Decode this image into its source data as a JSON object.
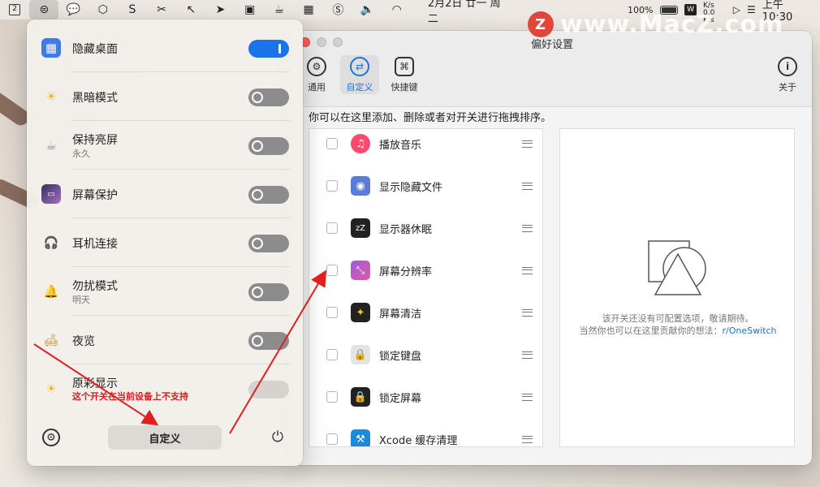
{
  "menubar": {
    "icons": [
      "2",
      "onedrag-icon",
      "wechat-icon",
      "coinbase-icon",
      "scrivener-icon",
      "papercut-icon",
      "cursor-icon",
      "send-icon",
      "screen-icon",
      "coffee-icon",
      "grid-icon",
      "s-icon",
      "volume-icon",
      "wifi-icon"
    ],
    "box_label": "2",
    "date": "2月2日 廿一 周二",
    "battery": "100%",
    "net_up": "0.0 K/s",
    "net_down": "0.0 K/s",
    "time": "上午 10:30"
  },
  "watermark": {
    "logo": "Z",
    "text": "www.MacZ.com"
  },
  "dropdown": {
    "items": [
      {
        "title": "隐藏桌面",
        "subtitle": "",
        "state": "on",
        "icon": "grid-icon",
        "color": "#3e7be6"
      },
      {
        "title": "黑暗模式",
        "subtitle": "",
        "state": "off",
        "icon": "sun-icon",
        "color": "#f3b61f"
      },
      {
        "title": "保持亮屏",
        "subtitle": "永久",
        "state": "off",
        "icon": "coffee-icon",
        "color": "#ffffff"
      },
      {
        "title": "屏幕保护",
        "subtitle": "",
        "state": "off",
        "icon": "screensaver-icon",
        "color": "#3b2f5e"
      },
      {
        "title": "耳机连接",
        "subtitle": "",
        "state": "off",
        "icon": "headphones-icon",
        "color": "#f0a030"
      },
      {
        "title": "勿扰模式",
        "subtitle": "明天",
        "state": "off",
        "icon": "bell-icon",
        "color": "#e0a030"
      },
      {
        "title": "夜览",
        "subtitle": "",
        "state": "off",
        "icon": "lamp-icon",
        "color": "#f0c040"
      },
      {
        "title": "原彩显示",
        "subtitle": "这个开关在当前设备上不支持",
        "state": "disabled",
        "icon": "true-tone-icon",
        "color": "#f3b61f"
      }
    ],
    "custom_label": "自定义"
  },
  "prefs": {
    "title": "偏好设置",
    "tabs": [
      {
        "label": "通用",
        "icon": "gear-icon",
        "glyph": "⚙"
      },
      {
        "label": "自定义",
        "icon": "sliders-icon",
        "glyph": "⇄"
      },
      {
        "label": "快捷键",
        "icon": "command-icon",
        "glyph": "⌘"
      }
    ],
    "about_label": "关于",
    "about_glyph": "i",
    "instruction": "你可以在这里添加、删除或者对开关进行拖拽排序。",
    "list": [
      {
        "label": "播放音乐",
        "icon": "music-icon",
        "color": "#fa4b6c"
      },
      {
        "label": "显示隐藏文件",
        "icon": "eye-icon",
        "color": "#5a7bd8"
      },
      {
        "label": "显示器休眠",
        "icon": "sleep-display-icon",
        "color": "#222222"
      },
      {
        "label": "屏幕分辨率",
        "icon": "resolution-icon",
        "color": "#9c5ce0"
      },
      {
        "label": "屏幕清洁",
        "icon": "clean-screen-icon",
        "color": "#222222"
      },
      {
        "label": "锁定键盘",
        "icon": "keyboard-lock-icon",
        "color": "#d8d8d8"
      },
      {
        "label": "锁定屏幕",
        "icon": "screen-lock-icon",
        "color": "#222222"
      },
      {
        "label": "Xcode 缓存清理",
        "icon": "xcode-icon",
        "color": "#1c8ad8"
      }
    ],
    "detail": {
      "line1": "该开关还没有可配置选项，敬请期待。",
      "line2_prefix": "当然你也可以在这里贡献你的想法：",
      "link": "r/OneSwitch"
    }
  },
  "colors": {
    "accent": "#1a73e8",
    "arrow": "#e02020",
    "warning": "#d62020"
  }
}
